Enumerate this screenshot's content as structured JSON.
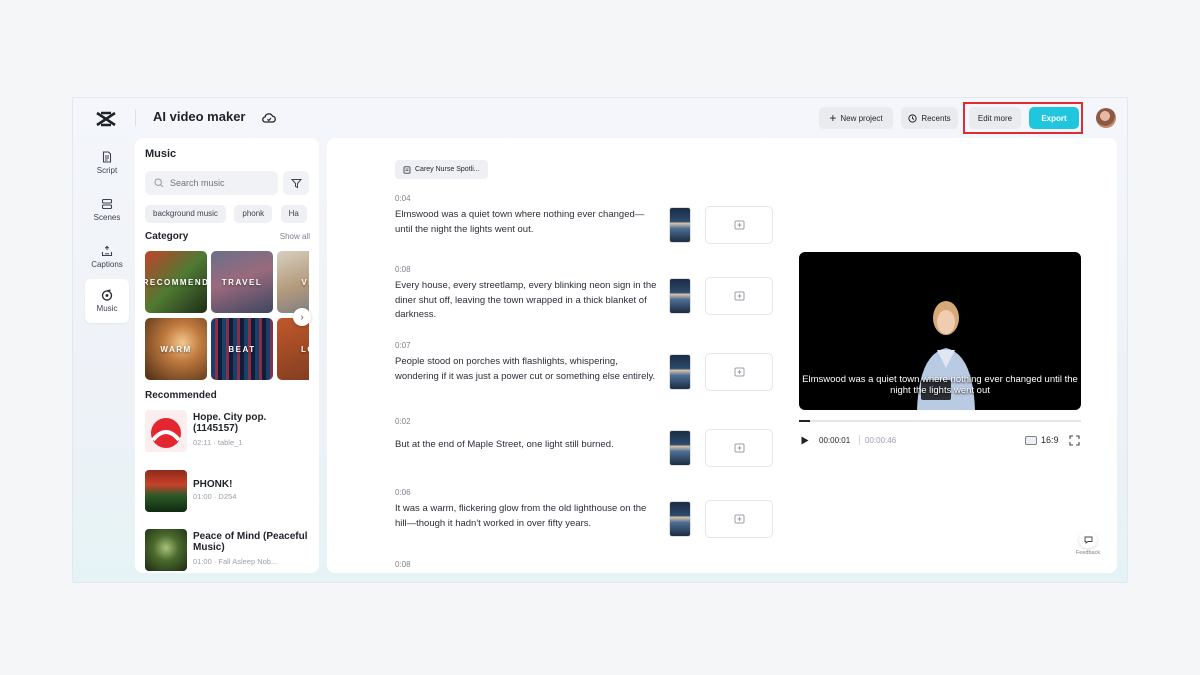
{
  "header": {
    "app_title": "AI video maker",
    "new_project_label": "New project",
    "recents_label": "Recents",
    "edit_more_label": "Edit more",
    "export_label": "Export"
  },
  "nav": {
    "items": [
      {
        "label": "Script",
        "icon": "script-icon"
      },
      {
        "label": "Scenes",
        "icon": "scenes-icon"
      },
      {
        "label": "Captions",
        "icon": "captions-icon"
      },
      {
        "label": "Music",
        "icon": "music-icon",
        "active": true
      }
    ]
  },
  "music_panel": {
    "title": "Music",
    "search_placeholder": "Search music",
    "chips": [
      "background music",
      "phonk",
      "Ha"
    ],
    "category_title": "Category",
    "show_all": "Show all",
    "categories": [
      "RECOMMEND",
      "TRAVEL",
      "VL",
      "WARM",
      "BEAT",
      "LO"
    ],
    "recommended_title": "Recommended",
    "tracks": [
      {
        "name": "Hope. City pop. (1145157)",
        "meta": "02:11 · table_1"
      },
      {
        "name": "PHONK!",
        "meta": "01:00 · D254"
      },
      {
        "name": "Peace of Mind (Peaceful Music)",
        "meta": "01:00 · Fall Asleep Nob..."
      }
    ]
  },
  "script": {
    "source_chip": "Carey Nurse Spotli...",
    "scenes": [
      {
        "time": "0:04",
        "text": "Elmswood was a quiet town where nothing ever changed—until the night the lights went out."
      },
      {
        "time": "0:08",
        "text": "Every house, every streetlamp, every blinking neon sign in the diner shut off, leaving the town wrapped in a thick blanket of darkness."
      },
      {
        "time": "0:07",
        "text": "People stood on porches with flashlights, whispering, wondering if it was just a power cut or something else entirely."
      },
      {
        "time": "0:02",
        "text": "But at the end of Maple Street, one light still burned."
      },
      {
        "time": "0:06",
        "text": "It was a warm, flickering glow from the old lighthouse on the hill—though it hadn't worked in over fifty years."
      },
      {
        "time": "0:08",
        "text": ""
      }
    ]
  },
  "preview": {
    "caption": "Elmswood was a quiet town where nothing ever changed until the night the lights went out",
    "current_time": "00:00:01",
    "total_time": "00:00:46",
    "progress_fraction": 0.04,
    "aspect_ratio": "16:9",
    "feedback_label": "Feedback"
  },
  "colors": {
    "accent": "#1fc6dd",
    "highlight": "#e02b35"
  }
}
